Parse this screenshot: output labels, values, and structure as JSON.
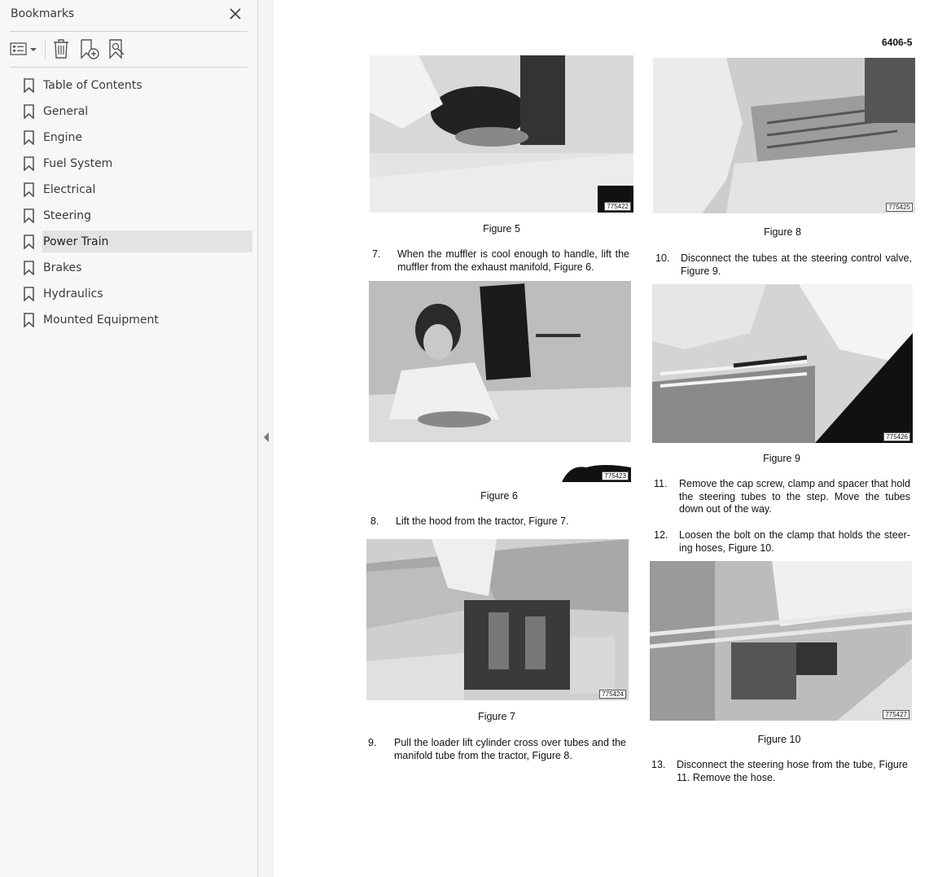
{
  "sidebar": {
    "title": "Bookmarks",
    "toolbar": {
      "options_icon": "list-options-icon",
      "delete_icon": "trash-icon",
      "add_icon": "add-bookmark-icon",
      "find_icon": "find-bookmark-icon"
    },
    "items": [
      {
        "label": "Table of Contents"
      },
      {
        "label": "General"
      },
      {
        "label": "Engine"
      },
      {
        "label": "Fuel System"
      },
      {
        "label": "Electrical"
      },
      {
        "label": "Steering"
      },
      {
        "label": "Power Train",
        "selected": true
      },
      {
        "label": "Brakes"
      },
      {
        "label": "Hydraulics"
      },
      {
        "label": "Mounted Equipment"
      }
    ]
  },
  "page": {
    "page_number": "6406-5",
    "figures": {
      "f5": {
        "caption": "Figure 5",
        "id": "775422"
      },
      "f6": {
        "caption": "Figure 6",
        "id": "775423"
      },
      "f7": {
        "caption": "Figure 7",
        "id": "775424"
      },
      "f8": {
        "caption": "Figure 8",
        "id": "775425"
      },
      "f9": {
        "caption": "Figure 9",
        "id": "775426"
      },
      "f10": {
        "caption": "Figure 10",
        "id": "775427"
      }
    },
    "steps": {
      "s7": {
        "num": "7.",
        "text": "When the muffler is cool enough to handle, lift the muffler from the exhaust manifold, Figure 6."
      },
      "s8": {
        "num": "8.",
        "text": "Lift the hood from the tractor, Figure 7."
      },
      "s9": {
        "num": "9.",
        "text": "Pull the loader lift cylinder cross over tubes and the manifold tube from the tractor, Figure 8."
      },
      "s10": {
        "num": "10.",
        "text": "Disconnect the tubes at the steering control valve, Figure 9."
      },
      "s11": {
        "num": "11.",
        "text": "Remove the cap screw, clamp and spacer that hold the steering tubes to the step. Move the tubes down out of the way."
      },
      "s12": {
        "num": "12.",
        "text": "Loosen the bolt on the clamp that holds the steer-ing hoses, Figure 10."
      },
      "s13": {
        "num": "13.",
        "text": "Disconnect the steering hose from the tube, Figure 11. Remove the hose."
      }
    }
  }
}
